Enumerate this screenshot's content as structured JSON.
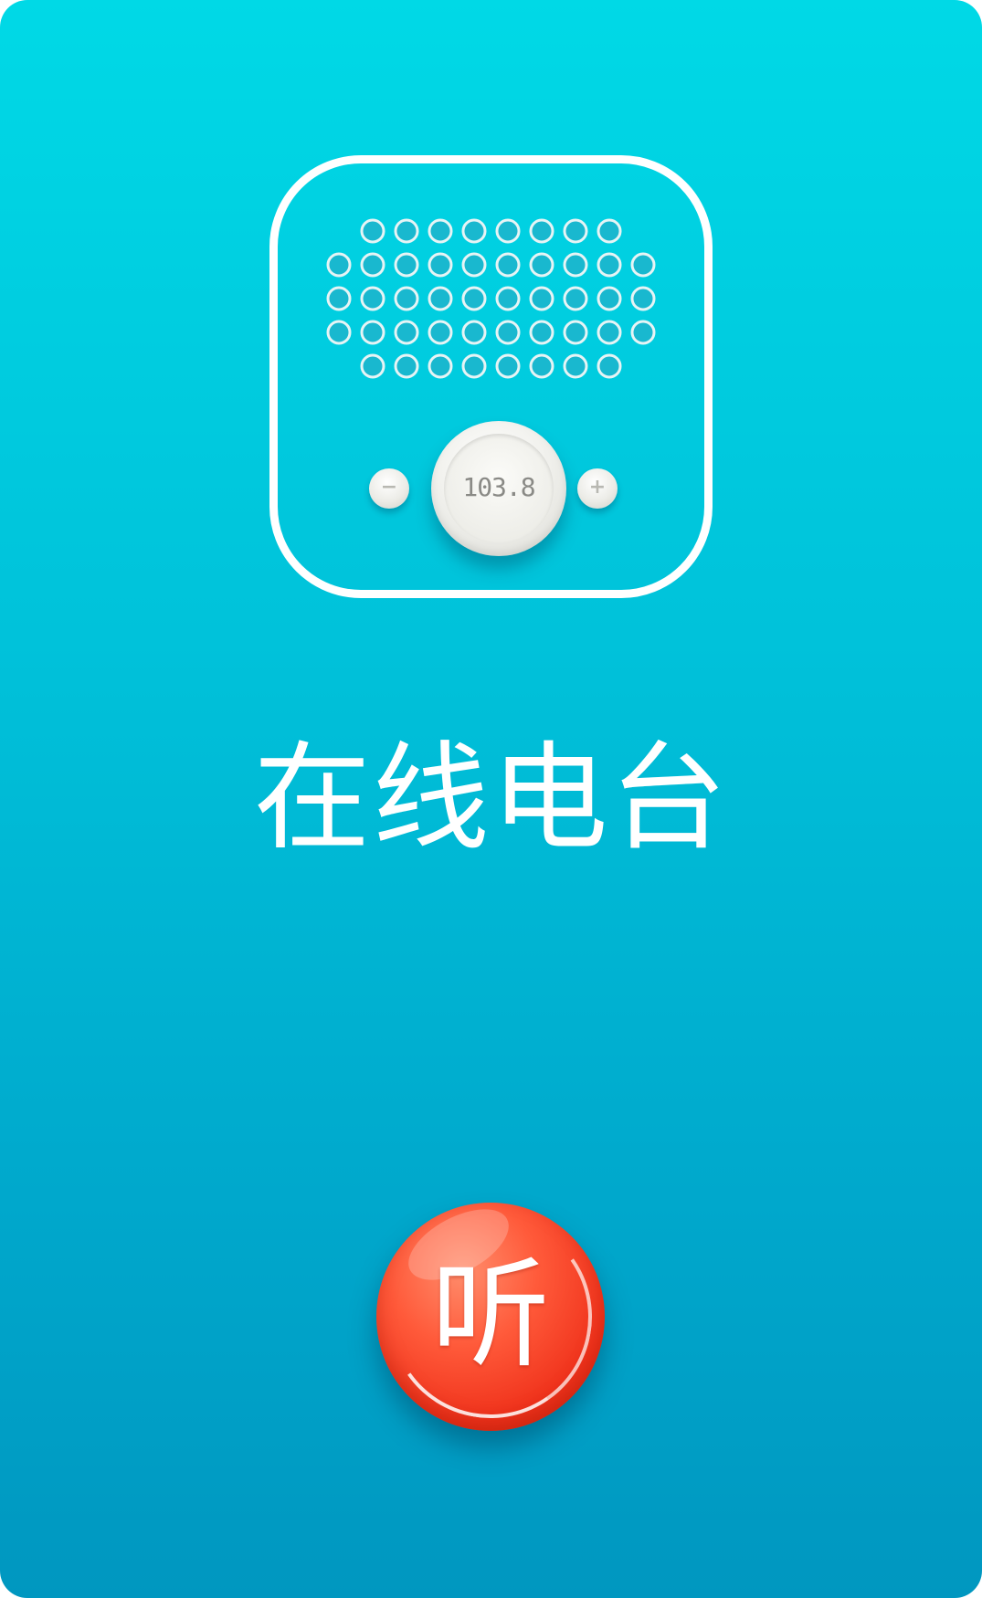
{
  "app": {
    "title": "在线电台",
    "frequency_display": "103.8",
    "minus_label": "−",
    "plus_label": "+",
    "listen_label": "听"
  },
  "colors": {
    "background_top": "#00d9e6",
    "background_bottom": "#0097c0",
    "icon_outline": "#ffffff",
    "listen_button": "#f0331c"
  },
  "icons": {
    "app_icon": "radio-icon",
    "speaker": "speaker-grille-icon"
  }
}
